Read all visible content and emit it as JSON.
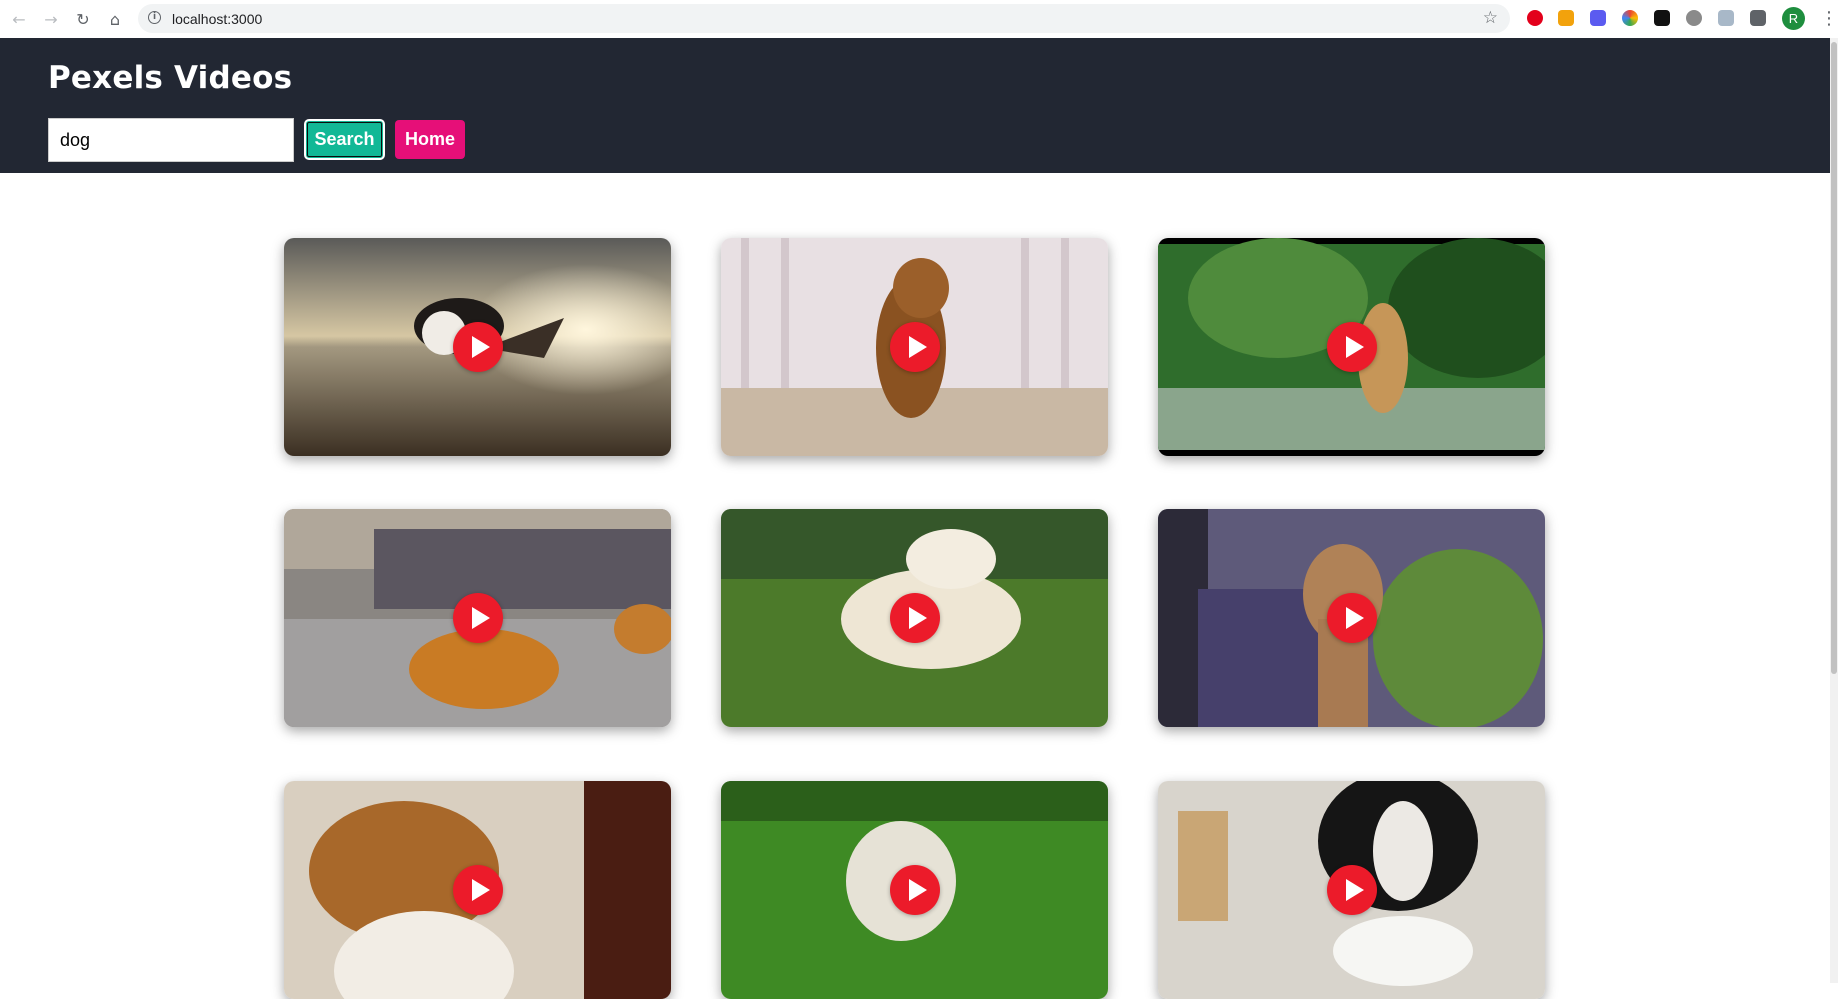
{
  "browser": {
    "url": "localhost:3000",
    "profile_initial": "R"
  },
  "header": {
    "title": "Pexels Videos",
    "search_value": "dog",
    "search_button": "Search",
    "home_button": "Home",
    "background": "#222733",
    "search_color": "#12b896",
    "home_color": "#e60f78"
  },
  "videos": [
    {
      "subject": "border collie puppy on beach at sunset"
    },
    {
      "subject": "dachshund puppy sitting by curtains"
    },
    {
      "subject": "golden retriever with person in park"
    },
    {
      "subject": "puppy playing by mirror on carpet"
    },
    {
      "subject": "golden puppy stretching on grass"
    },
    {
      "subject": "dog resting on purple armchair"
    },
    {
      "subject": "puppy profile close-up"
    },
    {
      "subject": "white terrier on lawn"
    },
    {
      "subject": "border collie drinking from bowl"
    }
  ],
  "play_icon_color": "#ec1b2a"
}
